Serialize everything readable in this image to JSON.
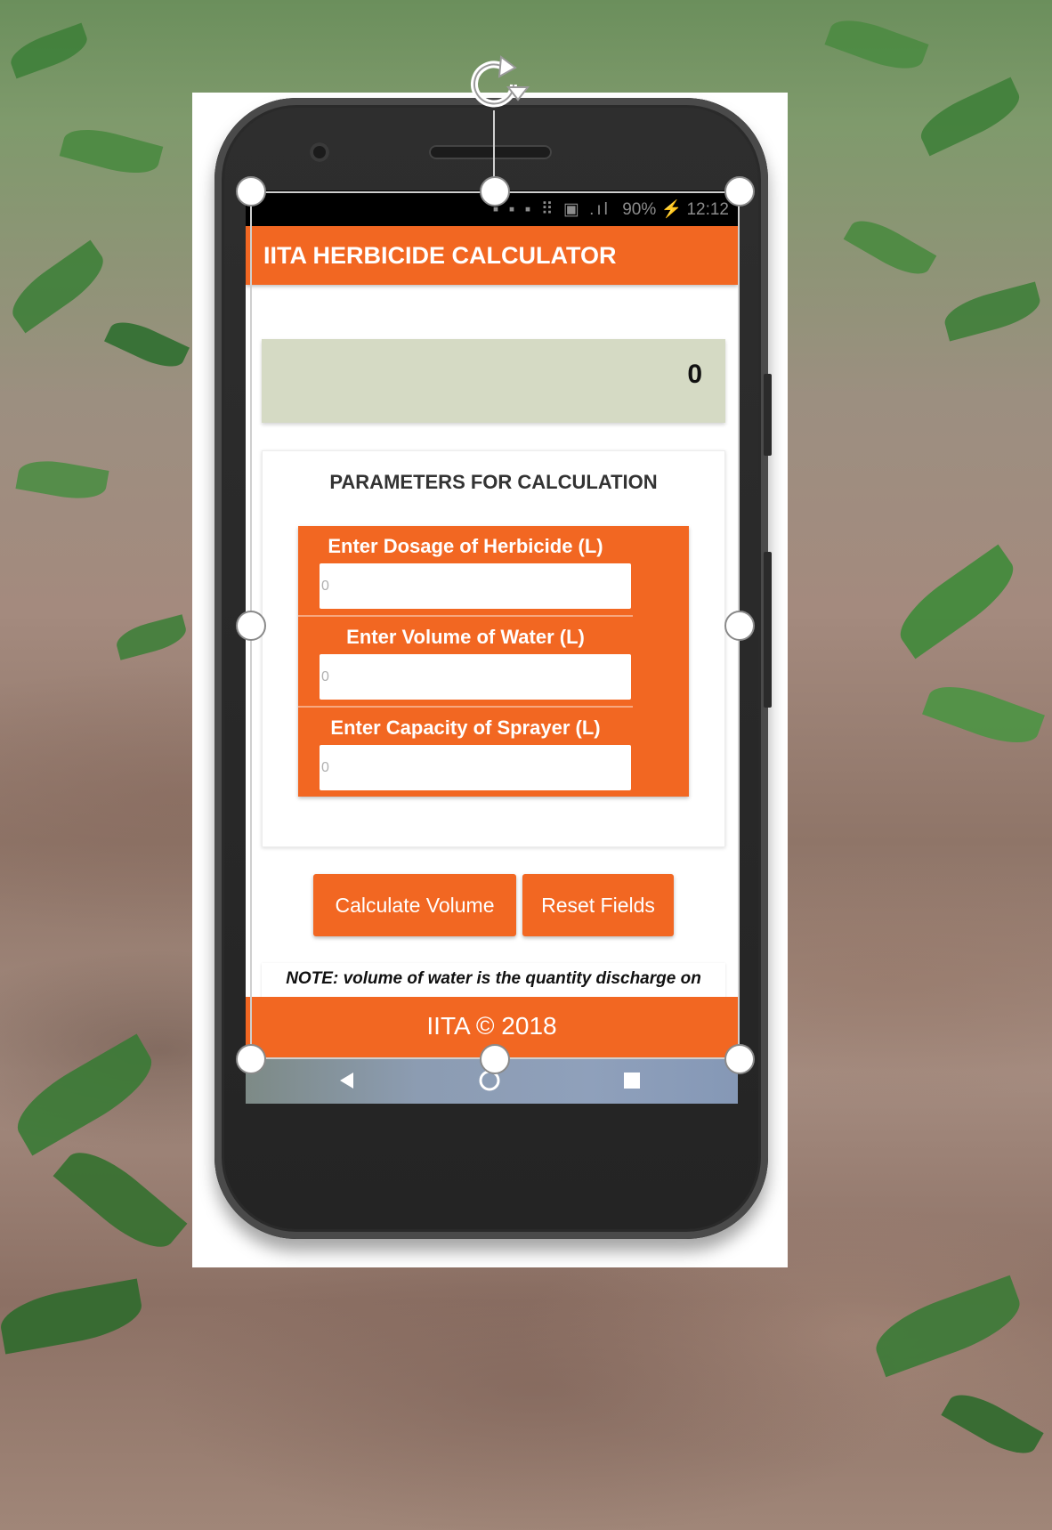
{
  "status_bar": {
    "icons": "▪ ▪ ▪ ⠿ ▣ .ıl",
    "battery": "90%",
    "time": "12:12"
  },
  "app": {
    "title": "IITA HERBICIDE CALCULATOR",
    "result_value": "0"
  },
  "parameters": {
    "title": "PARAMETERS FOR CALCULATION",
    "fields": [
      {
        "label": "Enter Dosage of Herbicide (L)",
        "placeholder": "0",
        "value": ""
      },
      {
        "label": "Enter Volume of Water (L)",
        "placeholder": "0",
        "value": ""
      },
      {
        "label": "Enter Capacity of Sprayer (L)",
        "placeholder": "0",
        "value": ""
      }
    ]
  },
  "buttons": {
    "calculate": "Calculate Volume",
    "reset": "Reset Fields"
  },
  "note": "NOTE: volume of water is the quantity discharge on",
  "footer": "IITA © 2018",
  "colors": {
    "primary": "#f26722",
    "result_background": "#d5dac4",
    "status_bar": "#000000"
  }
}
